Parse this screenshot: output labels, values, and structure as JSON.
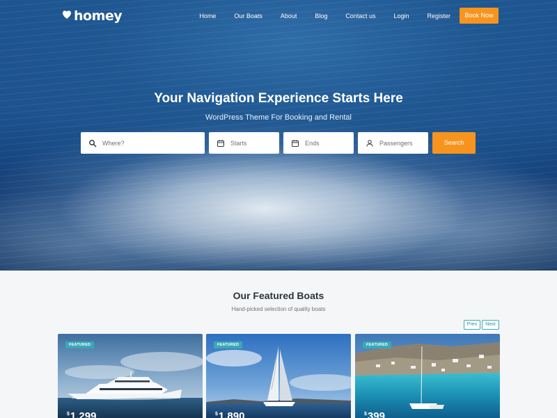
{
  "brand": {
    "name": "homey"
  },
  "nav": {
    "items": [
      "Home",
      "Our Boats",
      "About",
      "Blog",
      "Contact us",
      "Login",
      "Register"
    ],
    "cta_label": "Book Now"
  },
  "hero": {
    "title": "Your Navigation Experience Starts Here",
    "subtitle": "WordPress Theme For Booking and Rental"
  },
  "search": {
    "where_placeholder": "Where?",
    "starts_placeholder": "Starts",
    "ends_placeholder": "Ends",
    "passengers_placeholder": "Passengers",
    "button_label": "Search"
  },
  "featured": {
    "title": "Our Featured Boats",
    "subtitle": "Hand-picked selection of quality boats",
    "prev_label": "Prev",
    "next_label": "Next",
    "cards": [
      {
        "badge": "FEATURED",
        "currency": "$",
        "price": "1,299"
      },
      {
        "badge": "FEATURED",
        "currency": "$",
        "price": "1,890"
      },
      {
        "badge": "FEATURED",
        "currency": "$",
        "price": "399"
      }
    ]
  },
  "colors": {
    "accent": "#f7941d",
    "teal": "#3aa8b8",
    "background": "#f5f6f8"
  },
  "icons": [
    "heart-logo-icon",
    "search-icon",
    "calendar-icon",
    "user-icon"
  ]
}
